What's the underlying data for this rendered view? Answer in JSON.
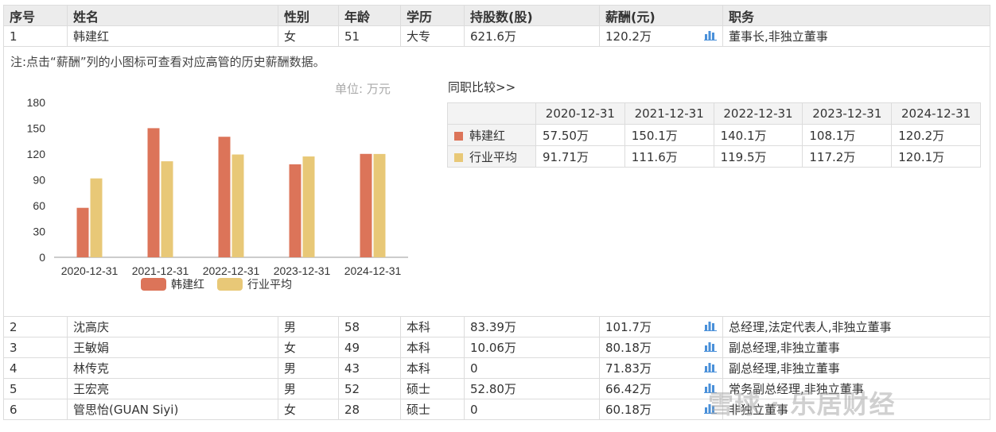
{
  "headers": [
    "序号",
    "姓名",
    "性别",
    "年龄",
    "学历",
    "持股数(股)",
    "薪酬(元)",
    "职务"
  ],
  "first_row": {
    "no": "1",
    "name": "韩建红",
    "gender": "女",
    "age": "51",
    "edu": "大专",
    "shares": "621.6万",
    "salary": "120.2万",
    "title": "董事长,非独立董事"
  },
  "detail": {
    "note": "注:点击“薪酬”列的小图标可查看对应高管的历史薪酬数据。",
    "unit": "单位: 万元",
    "compare_link": "同职比较>>",
    "compare_table": {
      "years": [
        "2020-12-31",
        "2021-12-31",
        "2022-12-31",
        "2023-12-31",
        "2024-12-31"
      ],
      "rows": [
        {
          "label": "韩建红",
          "values": [
            "57.50万",
            "150.1万",
            "140.1万",
            "108.1万",
            "120.2万"
          ]
        },
        {
          "label": "行业平均",
          "values": [
            "91.71万",
            "111.6万",
            "119.5万",
            "117.2万",
            "120.1万"
          ]
        }
      ]
    }
  },
  "chart_data": {
    "type": "bar",
    "categories": [
      "2020-12-31",
      "2021-12-31",
      "2022-12-31",
      "2023-12-31",
      "2024-12-31"
    ],
    "series": [
      {
        "name": "韩建红",
        "values": [
          57.5,
          150.1,
          140.1,
          108.1,
          120.2
        ],
        "color": "#dc7459"
      },
      {
        "name": "行业平均",
        "values": [
          91.71,
          111.6,
          119.5,
          117.2,
          120.1
        ],
        "color": "#e8c877"
      }
    ],
    "yticks": [
      "0",
      "30",
      "60",
      "90",
      "120",
      "150",
      "180"
    ],
    "ylim": [
      0,
      180
    ],
    "legend_position": "bottom"
  },
  "rows": [
    {
      "no": "2",
      "name": "沈高庆",
      "gender": "男",
      "age": "58",
      "edu": "本科",
      "shares": "83.39万",
      "salary": "101.7万",
      "title": "总经理,法定代表人,非独立董事"
    },
    {
      "no": "3",
      "name": "王敏娟",
      "gender": "女",
      "age": "49",
      "edu": "本科",
      "shares": "10.06万",
      "salary": "80.18万",
      "title": "副总经理,非独立董事"
    },
    {
      "no": "4",
      "name": "林传克",
      "gender": "男",
      "age": "43",
      "edu": "本科",
      "shares": "0",
      "salary": "71.83万",
      "title": "副总经理,非独立董事"
    },
    {
      "no": "5",
      "name": "王宏亮",
      "gender": "男",
      "age": "52",
      "edu": "硕士",
      "shares": "52.80万",
      "salary": "66.42万",
      "title": "常务副总经理,非独立董事"
    },
    {
      "no": "6",
      "name": "管思怡(GUAN Siyi)",
      "gender": "女",
      "age": "28",
      "edu": "硕士",
      "shares": "0",
      "salary": "60.18万",
      "title": "非独立董事"
    }
  ],
  "watermark": "雪球 · 乐居财经",
  "colors": {
    "header_bg": "#ececec",
    "icon_blue": "#4a90d9",
    "border": "#dcdcdc"
  }
}
